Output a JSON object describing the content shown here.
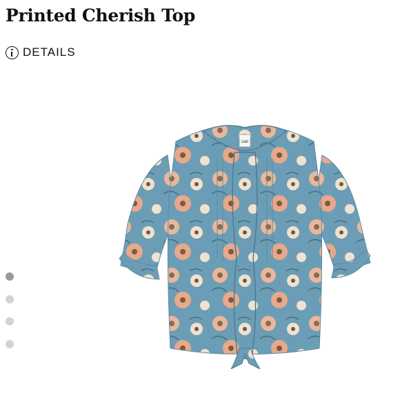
{
  "product": {
    "title": "Printed Cherish Top",
    "details_label": "DETAILS",
    "image_alt": "floral blouse",
    "brand_label": "cab"
  },
  "gallery": {
    "slide_count": 4,
    "active_index": 0
  },
  "colors": {
    "fabric_blue": "#6b9db6",
    "flower_peach": "#e9b79b",
    "flower_cream": "#efe2cf",
    "dot_active": "#9a9a9a",
    "dot_inactive": "#d3d3d3"
  }
}
